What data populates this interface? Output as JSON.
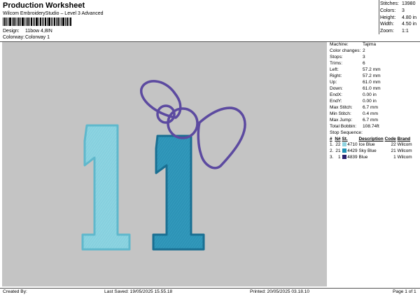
{
  "header": {
    "title": "Production Worksheet",
    "subtitle": "Wilcom EmbroideryStudio – Level 3 Advanced",
    "design_label": "Design:",
    "design_value": "11bow 4,8IN",
    "colorway_label": "Colorway:",
    "colorway_value": "Colorway 1"
  },
  "stats": [
    {
      "label": "Stitches:",
      "value": "13980"
    },
    {
      "label": "Colors:",
      "value": "3"
    },
    {
      "label": "Height:",
      "value": "4.80 in"
    },
    {
      "label": "Width:",
      "value": "4.50 in"
    },
    {
      "label": "Zoom:",
      "value": "1:1"
    }
  ],
  "info": [
    {
      "label": "Machine:",
      "value": "Tajima"
    },
    {
      "label": "Color changes:",
      "value": "2"
    },
    {
      "label": "Stops:",
      "value": "3"
    },
    {
      "label": "Trims:",
      "value": "6"
    },
    {
      "label": "Left:",
      "value": "57.2 mm"
    },
    {
      "label": "Right:",
      "value": "57.2 mm"
    },
    {
      "label": "Up:",
      "value": "61.0 mm"
    },
    {
      "label": "Down:",
      "value": "61.0 mm"
    },
    {
      "label": "EndX:",
      "value": "0.00 in"
    },
    {
      "label": "EndY:",
      "value": "0.00 in"
    },
    {
      "label": "Max Stitch:",
      "value": "6.7 mm"
    },
    {
      "label": "Min Stitch:",
      "value": "0.4 mm"
    },
    {
      "label": "Max Jump:",
      "value": "6.7 mm"
    },
    {
      "label": "Total Bobbin:",
      "value": "108.74ft"
    }
  ],
  "stop_sequence": {
    "title": "Stop Sequence:",
    "headers": [
      "#",
      "N#",
      "St.",
      "Description",
      "Code",
      "Brand"
    ],
    "rows": [
      {
        "num": "1.",
        "needle": "22",
        "code_no": "4710",
        "description": "Ice Blue",
        "code": "22",
        "brand": "Wilcom",
        "color": "#8fd3e0"
      },
      {
        "num": "2.",
        "needle": "21",
        "code_no": "4429",
        "description": "Sky Blue",
        "code": "21",
        "brand": "Wilcom",
        "color": "#1f8fb3"
      },
      {
        "num": "3.",
        "needle": "1",
        "code_no": "4839",
        "description": "Blue",
        "code": "1",
        "brand": "Wilcom",
        "color": "#2a1f6b"
      }
    ]
  },
  "design_colors": {
    "background": "#c4c4c4",
    "ice_blue": "#86d0de",
    "ice_blue_edge": "#5fb8cc",
    "sky_blue": "#2d93b6",
    "sky_blue_edge": "#1a6f92",
    "bow": "#5c4aa0"
  },
  "footer": {
    "created_by": "Created By:",
    "last_saved": "Last Saved: 19/05/2025 15.55.18",
    "printed": "Printed: 20/05/2025 03.18.10",
    "page": "Page 1 of 1"
  }
}
